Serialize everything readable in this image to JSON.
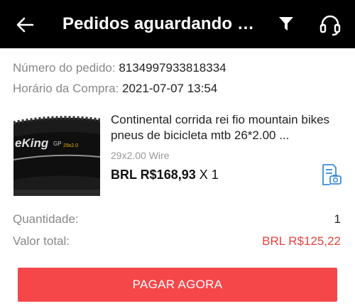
{
  "header": {
    "title": "Pedidos aguardando pa...",
    "back_icon": "arrow-left-icon",
    "filter_icon": "filter-icon",
    "support_icon": "headset-icon"
  },
  "order": {
    "number_label": "Número do pedido:",
    "number_value": "8134997933818334",
    "time_label": "Horário da Compra:",
    "time_value": "2021-07-07 13:54"
  },
  "product": {
    "title": "Continental corrida rei fio mountain bikes pneus de bicicleta mtb 26*2.00 ...",
    "sku": "29x2.00 Wire",
    "price": "BRL R$168,93",
    "quantity": "X 1",
    "image_text": "eKing",
    "receipt_icon": "receipt-photo-icon"
  },
  "summary": {
    "quantity_label": "Quantidade:",
    "quantity_value": "1",
    "total_label": "Valor total:",
    "total_value": "BRL R$125,22"
  },
  "action": {
    "pay_label": "PAGAR AGORA"
  },
  "colors": {
    "header_bg": "#000000",
    "accent_red": "#f5474a",
    "total_red": "#e8433e"
  }
}
